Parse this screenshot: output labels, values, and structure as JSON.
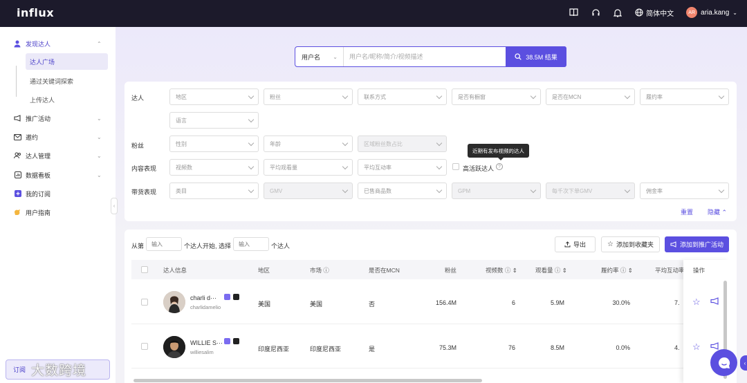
{
  "app": {
    "logo": "influx"
  },
  "header": {
    "language": "简体中文",
    "user_initials": "AR",
    "username": "aria.kang"
  },
  "sidebar": {
    "items": [
      {
        "label": "发现达人",
        "icon": "user-search-icon",
        "expanded": true
      },
      {
        "label": "推广活动",
        "icon": "megaphone-icon"
      },
      {
        "label": "邀约",
        "icon": "mail-icon"
      },
      {
        "label": "达人管理",
        "icon": "users-icon"
      },
      {
        "label": "数据看板",
        "icon": "dashboard-icon"
      },
      {
        "label": "我的订阅",
        "icon": "subscription-icon"
      },
      {
        "label": "用户指南",
        "icon": "guide-icon"
      }
    ],
    "subitems": [
      "达人广场",
      "通过关键词探索",
      "上传达人"
    ],
    "active_sub": "达人广场",
    "subscribe_label": "订阅",
    "watermark": "大数跨境"
  },
  "search": {
    "type": "用户名",
    "placeholder": "用户名/昵称/简介/视频描述",
    "button": "38.5M 结果"
  },
  "filters": {
    "row_labels": {
      "creator": "达人",
      "fans": "粉丝",
      "content": "内容表现",
      "commerce": "带货表现"
    },
    "creator": [
      "地区",
      "粉丝",
      "联系方式",
      "是否有橱窗",
      "是否在MCN",
      "履约率",
      "语言"
    ],
    "fans": [
      "性别",
      "年龄",
      "区域粉丝数占比"
    ],
    "content": [
      "视频数",
      "平均观看量",
      "平均互动率"
    ],
    "active_label": "高活跃达人",
    "tooltip": "近期有发布视频的达人",
    "commerce": [
      "类目",
      "GMV",
      "已售商品数",
      "GPM",
      "每千次下单GMV",
      "佣金率"
    ],
    "reset": "重置",
    "hide": "隐藏"
  },
  "table_controls": {
    "from_label": "从第",
    "from_mid": "个达人开始, 选择",
    "from_end": "个达人",
    "input_placeholder": "输入",
    "export": "导出",
    "add_favorites": "添加到收藏夹",
    "add_campaign": "添加到推广活动"
  },
  "table": {
    "columns": [
      "达人信息",
      "地区",
      "市场",
      "是否在MCN",
      "粉丝",
      "视频数",
      "观看量",
      "履约率",
      "平均互动率",
      "操作"
    ],
    "rows": [
      {
        "name": "charli d···",
        "handle": "charlidamelio",
        "region": "美国",
        "market": "美国",
        "mcn": "否",
        "fans": "156.4M",
        "videos": "6",
        "views": "5.9M",
        "fulfillment": "30.0%",
        "engagement": "7."
      },
      {
        "name": "WILLIE S···",
        "handle": "williesalim",
        "region": "印度尼西亚",
        "market": "印度尼西亚",
        "mcn": "是",
        "fans": "75.3M",
        "videos": "76",
        "views": "8.5M",
        "fulfillment": "0.0%",
        "engagement": "4."
      }
    ]
  },
  "colors": {
    "accent": "#5b4fe0",
    "topbar": "#1c1a2b"
  }
}
